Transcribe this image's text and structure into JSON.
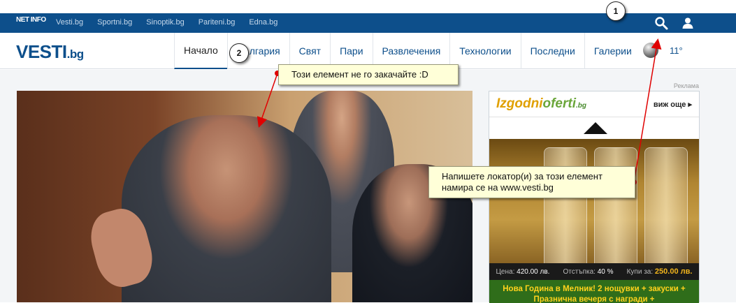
{
  "topbar": {
    "logo_text": "NET INFO",
    "links": [
      "Vesti.bg",
      "Sportni.bg",
      "Sinoptik.bg",
      "Pariteni.bg",
      "Edna.bg"
    ],
    "icons": [
      "search-icon",
      "user-icon"
    ]
  },
  "header": {
    "logo_main": "VESTI",
    "logo_suffix": ".bg",
    "menu": [
      "Начало",
      "България",
      "Свят",
      "Пари",
      "Развлечения",
      "Технологии",
      "Последни",
      "Галерии"
    ],
    "active_menu": "Начало",
    "weather_icon": "weather-moon-icon",
    "temperature": "11°"
  },
  "ad": {
    "label": "Реклама",
    "logo_part1": "Izgodni",
    "logo_part2": "oferti",
    "logo_suffix": ".bg",
    "more_label": "виж още",
    "price_label": "Цена:",
    "price_value": "420.00 лв.",
    "discount_label": "Отстъпка:",
    "discount_value": "40 %",
    "buy_label": "Купи за:",
    "buy_value": "250.00 лв.",
    "title": "Нова Година в Мелник! 2 нощувки + закуски + Празнична вечеря с награди +"
  },
  "annotations": {
    "marker1": "1",
    "marker2": "2",
    "callout1": "Напишете локатор(и) за този елемент намира се на www.vesti.bg",
    "callout2": "Този елемент не го закачайте :D"
  },
  "colors": {
    "brand_blue": "#0d4f8b",
    "callout_bg": "#ffffd8",
    "arrow_red": "#e00000",
    "ad_price_accent": "#f2b51c"
  }
}
